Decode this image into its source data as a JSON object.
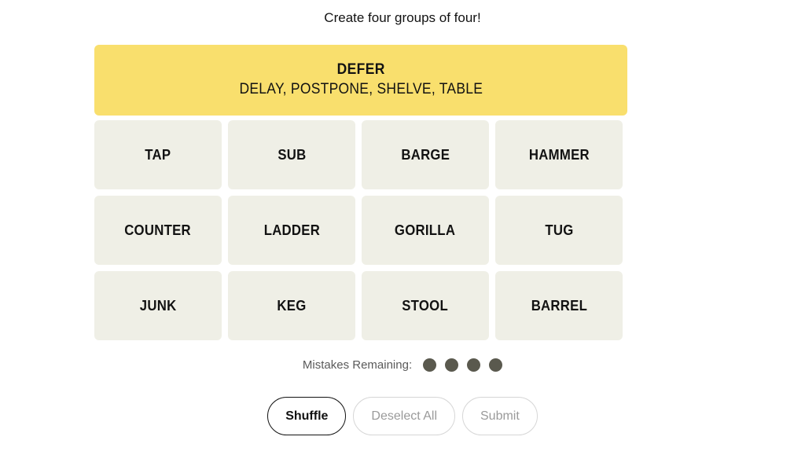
{
  "header": {
    "tagline": "Create four groups of four!"
  },
  "board": {
    "solved_groups": [
      {
        "title": "DEFER",
        "members": "DELAY, POSTPONE, SHELVE, TABLE",
        "color": "#F9DF6D"
      }
    ],
    "rows": [
      [
        "TAP",
        "SUB",
        "BARGE",
        "HAMMER"
      ],
      [
        "COUNTER",
        "LADDER",
        "GORILLA",
        "TUG"
      ],
      [
        "JUNK",
        "KEG",
        "STOOL",
        "BARREL"
      ]
    ],
    "tile_color": "#EFEFE6"
  },
  "mistakes": {
    "label": "Mistakes Remaining:",
    "remaining": 4,
    "dot_color": "#5A594E"
  },
  "controls": {
    "shuffle_label": "Shuffle",
    "deselect_label": "Deselect All",
    "submit_label": "Submit"
  }
}
